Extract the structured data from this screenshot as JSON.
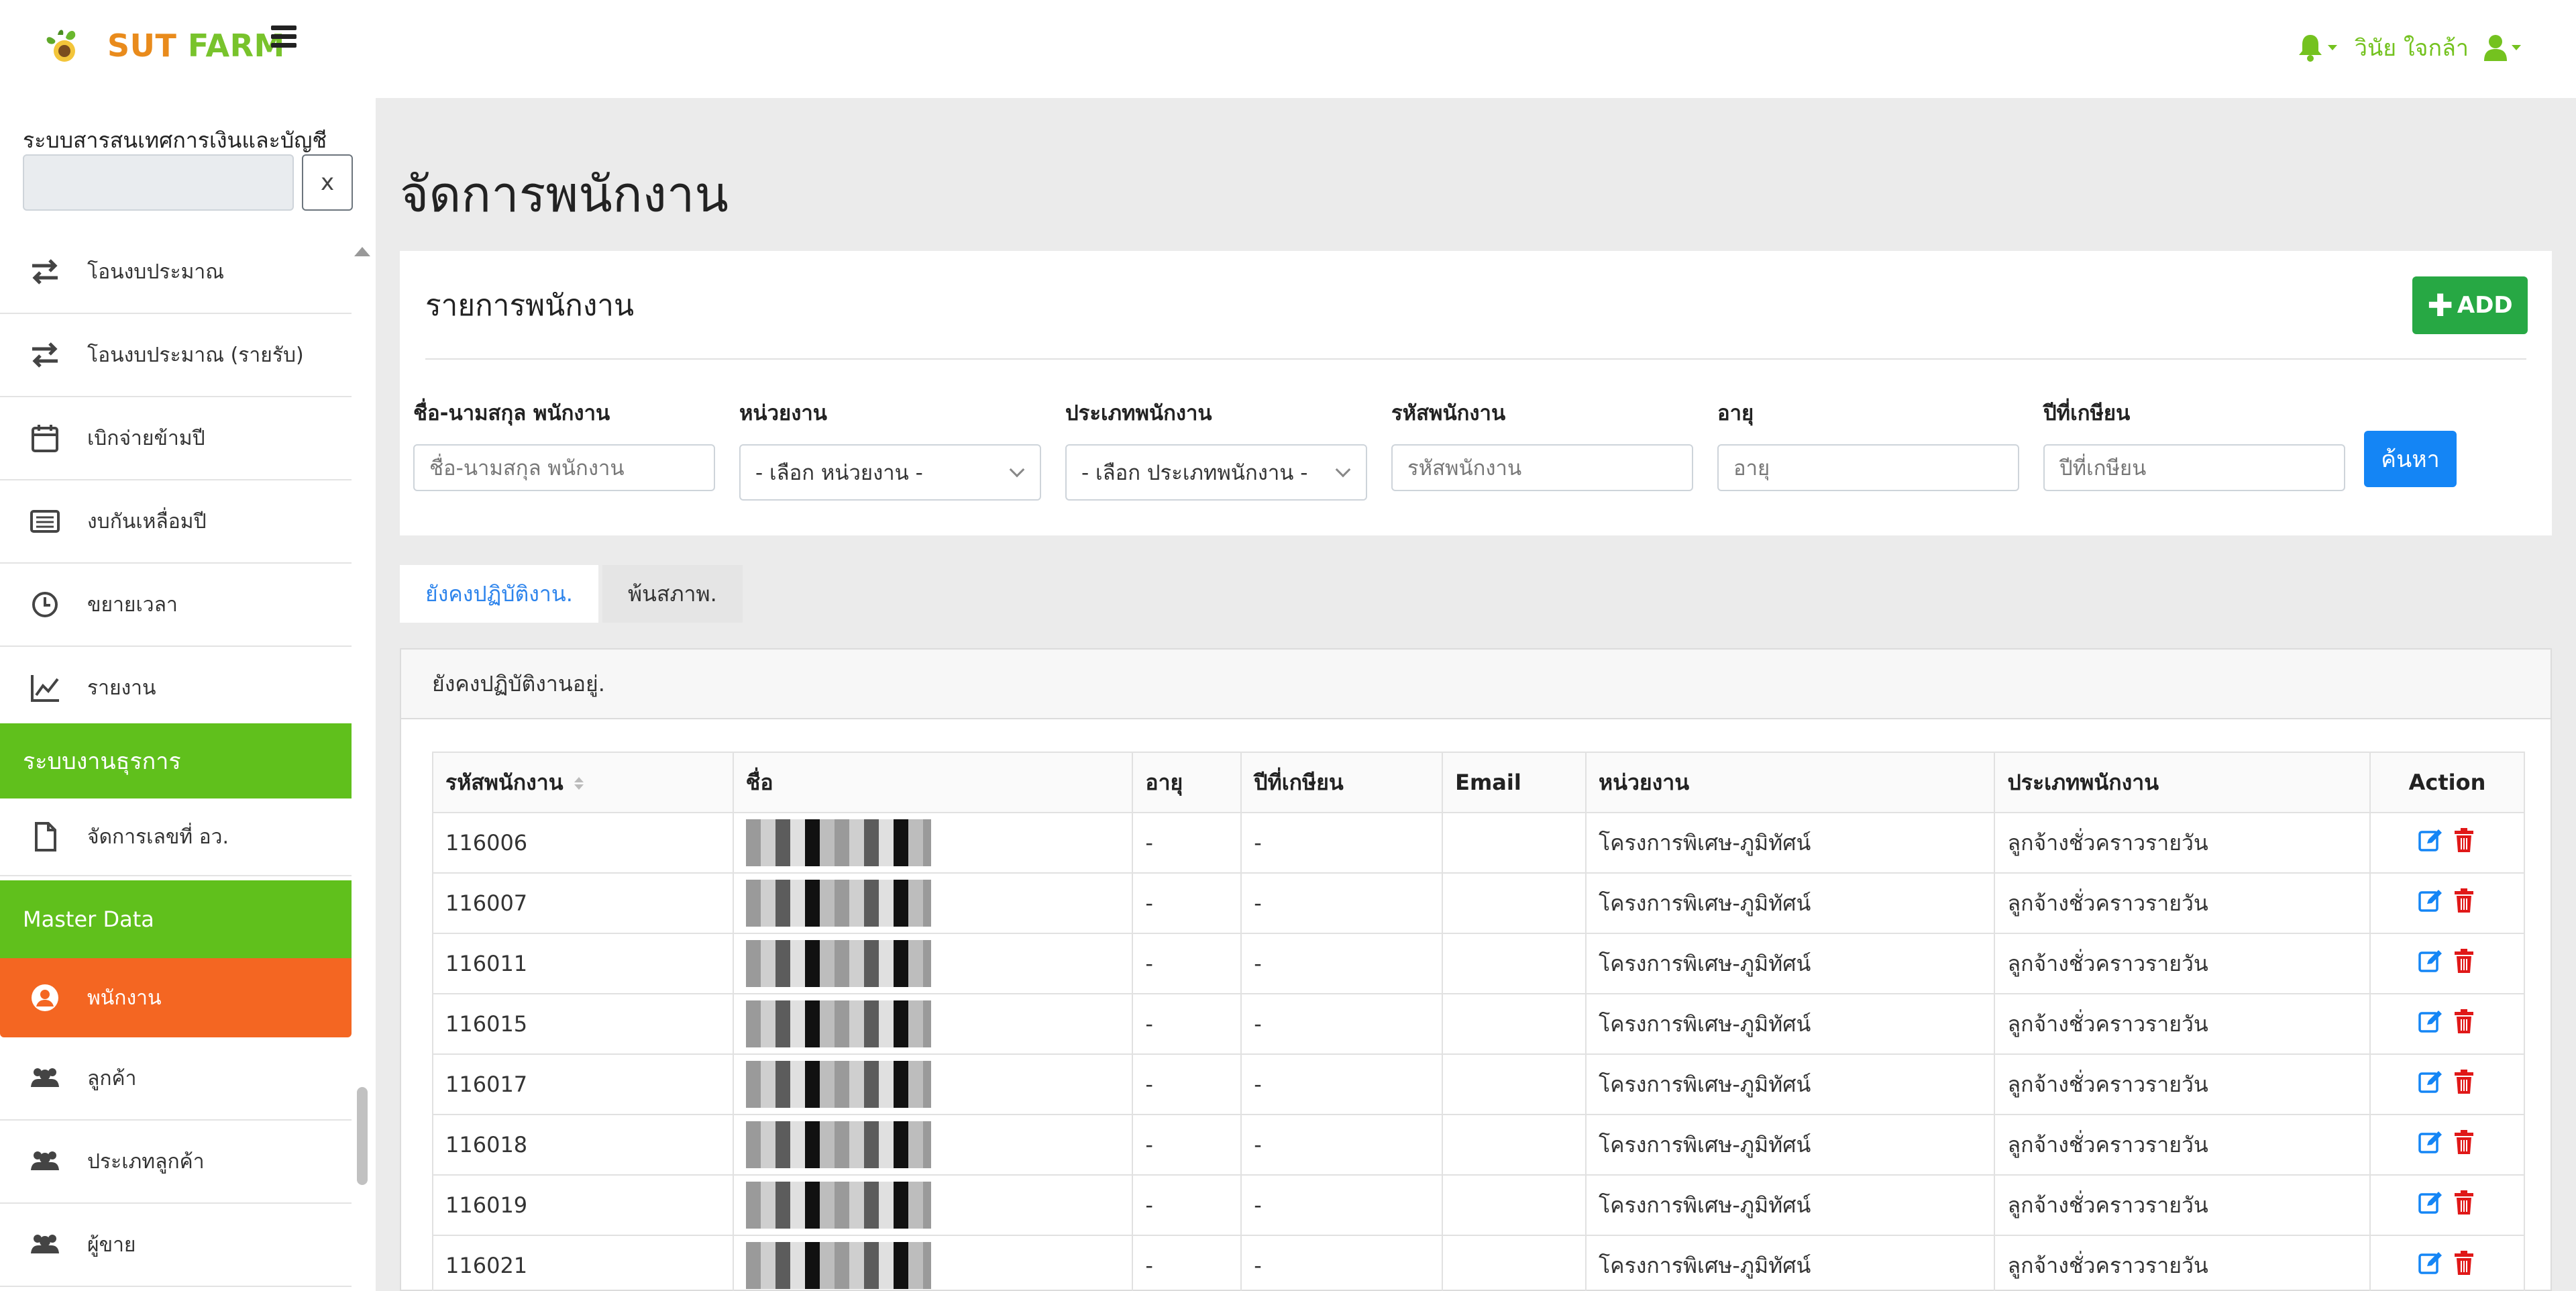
{
  "brand": {
    "part1": "SUT ",
    "part2": "FARM"
  },
  "header": {
    "user_name": "วินัย ใจกล้า"
  },
  "sidebar": {
    "title": "ระบบสารสนเทศการเงินและบัญชี",
    "clear_label": "x",
    "items_top": [
      {
        "label": "โอนงบประมาณ",
        "icon": "transfer-icon"
      },
      {
        "label": "โอนงบประมาณ (รายรับ)",
        "icon": "transfer-icon"
      },
      {
        "label": "เบิกจ่ายข้ามปี",
        "icon": "calendar-icon"
      },
      {
        "label": "งบกันเหลื่อมปี",
        "icon": "list-icon"
      },
      {
        "label": "ขยายเวลา",
        "icon": "clock-icon"
      },
      {
        "label": "รายงาน",
        "icon": "chart-line-icon"
      }
    ],
    "section_business": "ระบบงานธุรการ",
    "business_item": "จัดการเลขที่ อว.",
    "section_master": "Master Data",
    "master_items": [
      {
        "label": "พนักงาน",
        "icon": "user-circle-icon"
      },
      {
        "label": "ลูกค้า",
        "icon": "users-icon"
      },
      {
        "label": "ประเภทลูกค้า",
        "icon": "users-icon"
      },
      {
        "label": "ผู้ขาย",
        "icon": "users-icon"
      }
    ]
  },
  "page": {
    "title": "จัดการพนักงาน"
  },
  "card": {
    "title": "รายการพนักงาน",
    "add_label": "ADD"
  },
  "filters": {
    "name": {
      "label": "ชื่อ-นามสกุล พนักงาน",
      "placeholder": "ชื่อ-นามสกุล พนักงาน"
    },
    "unit": {
      "label": "หน่วยงาน",
      "value": "- เลือก หน่วยงาน -"
    },
    "type": {
      "label": "ประเภทพนักงาน",
      "value": "- เลือก ประเภทพนักงาน -"
    },
    "code": {
      "label": "รหัสพนักงาน",
      "placeholder": "รหัสพนักงาน"
    },
    "age": {
      "label": "อายุ",
      "placeholder": "อายุ"
    },
    "retire": {
      "label": "ปีที่เกษียน",
      "placeholder": "ปีที่เกษียน"
    },
    "search_label": "ค้นหา"
  },
  "tabs": {
    "active": "ยังคงปฏิบัติงาน.",
    "inactive": "พ้นสภาพ."
  },
  "panel": {
    "heading": "ยังคงปฏิบัติงานอยู่."
  },
  "table": {
    "headers": {
      "code": "รหัสพนักงาน",
      "name": "ชื่อ",
      "age": "อายุ",
      "retire": "ปีที่เกษียน",
      "email": "Email",
      "unit": "หน่วยงาน",
      "type": "ประเภทพนักงาน",
      "action": "Action"
    },
    "rows": [
      {
        "code": "116006",
        "age": "-",
        "retire": "-",
        "email": "",
        "unit": "โครงการพิเศษ-ภูมิทัศน์",
        "type": "ลูกจ้างชั่วคราวรายวัน"
      },
      {
        "code": "116007",
        "age": "-",
        "retire": "-",
        "email": "",
        "unit": "โครงการพิเศษ-ภูมิทัศน์",
        "type": "ลูกจ้างชั่วคราวรายวัน"
      },
      {
        "code": "116011",
        "age": "-",
        "retire": "-",
        "email": "",
        "unit": "โครงการพิเศษ-ภูมิทัศน์",
        "type": "ลูกจ้างชั่วคราวรายวัน"
      },
      {
        "code": "116015",
        "age": "-",
        "retire": "-",
        "email": "",
        "unit": "โครงการพิเศษ-ภูมิทัศน์",
        "type": "ลูกจ้างชั่วคราวรายวัน"
      },
      {
        "code": "116017",
        "age": "-",
        "retire": "-",
        "email": "",
        "unit": "โครงการพิเศษ-ภูมิทัศน์",
        "type": "ลูกจ้างชั่วคราวรายวัน"
      },
      {
        "code": "116018",
        "age": "-",
        "retire": "-",
        "email": "",
        "unit": "โครงการพิเศษ-ภูมิทัศน์",
        "type": "ลูกจ้างชั่วคราวรายวัน"
      },
      {
        "code": "116019",
        "age": "-",
        "retire": "-",
        "email": "",
        "unit": "โครงการพิเศษ-ภูมิทัศน์",
        "type": "ลูกจ้างชั่วคราวรายวัน"
      },
      {
        "code": "116021",
        "age": "-",
        "retire": "-",
        "email": "",
        "unit": "โครงการพิเศษ-ภูมิทัศน์",
        "type": "ลูกจ้างชั่วคราวรายวัน"
      }
    ]
  },
  "colors": {
    "brand_green": "#60c01c",
    "brand_orange": "#f46622",
    "add_green": "#27a844",
    "search_blue": "#1485f5",
    "edit_blue": "#1485f5",
    "delete_red": "#e01818"
  }
}
